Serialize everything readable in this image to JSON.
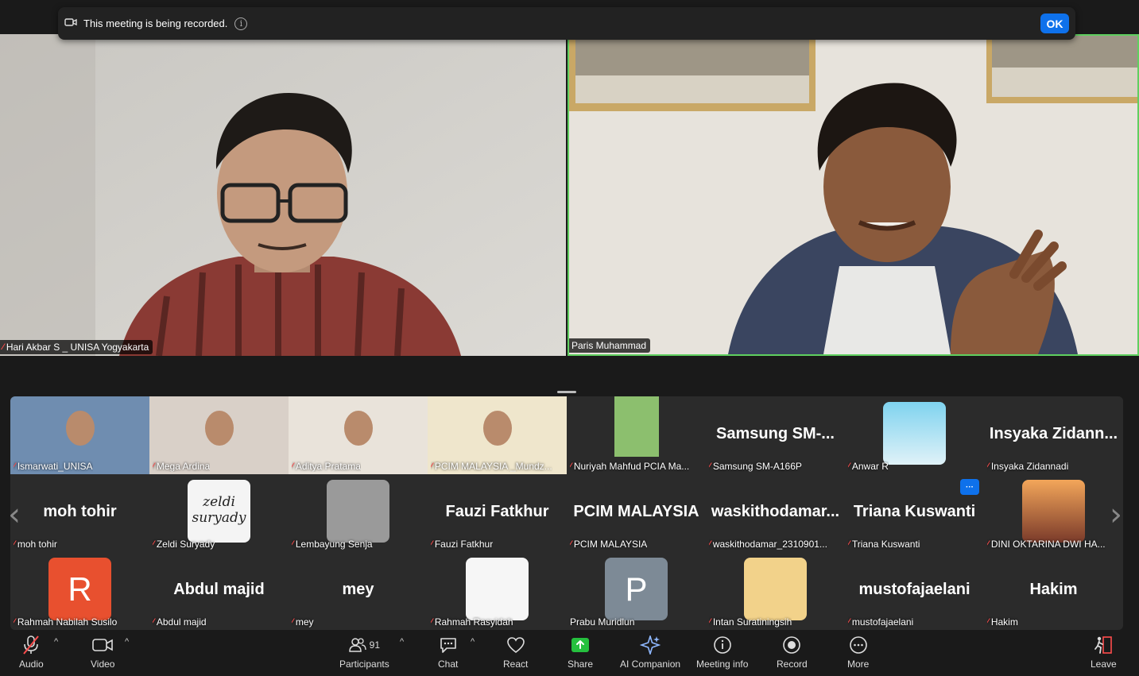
{
  "banner": {
    "text": "This meeting is being recorded.",
    "ok_label": "OK"
  },
  "speakers": [
    {
      "name": "Hari Akbar S _ UNISA Yogyakarta",
      "muted": true
    },
    {
      "name": "Paris Muhammad",
      "muted": false,
      "active": true
    }
  ],
  "gallery": {
    "rows": [
      [
        {
          "name": "Ismarwati_UNISA",
          "type": "video",
          "muted": true
        },
        {
          "name": "Mega Ardina",
          "type": "video",
          "muted": true
        },
        {
          "name": "Aditya Pratama",
          "type": "video",
          "muted": true
        },
        {
          "name": "PCIM MALAYSIA _Mundz...",
          "type": "video",
          "muted": true
        },
        {
          "name": "Nuriyah Mahfud PCIA Ma...",
          "type": "video",
          "muted": true
        },
        {
          "name": "Samsung SM-A166P",
          "display": "Samsung SM-...",
          "type": "name",
          "muted": true
        },
        {
          "name": "Anwar R",
          "type": "avatar",
          "muted": true
        },
        {
          "name": "Insyaka Zidannadi",
          "display": "Insyaka Zidann...",
          "type": "name",
          "muted": true
        }
      ],
      [
        {
          "name": "moh tohir",
          "display": "moh tohir",
          "type": "name",
          "muted": true
        },
        {
          "name": "Zeldi Suryady",
          "type": "avatar",
          "muted": true,
          "avatar_text": "zeldi suryady"
        },
        {
          "name": "Lembayung Senja",
          "type": "avatar",
          "muted": true
        },
        {
          "name": "Fauzi Fatkhur",
          "display": "Fauzi Fatkhur",
          "type": "name",
          "muted": true
        },
        {
          "name": "PCIM MALAYSIA",
          "display": "PCIM MALAYSIA",
          "type": "name",
          "muted": true
        },
        {
          "name": "waskithodamar_2310901...",
          "display": "waskithodamar...",
          "type": "name",
          "muted": true
        },
        {
          "name": "Triana Kuswanti",
          "display": "Triana Kuswanti",
          "type": "name",
          "muted": true
        },
        {
          "name": "DINI OKTARINA DWI HA...",
          "type": "avatar",
          "muted": true
        }
      ],
      [
        {
          "name": "Rahmah Nabilah Susilo",
          "type": "letter",
          "letter": "R",
          "color": "#e8502f",
          "muted": true
        },
        {
          "name": "Abdul majid",
          "display": "Abdul majid",
          "type": "name",
          "muted": true
        },
        {
          "name": "mey",
          "display": "mey",
          "type": "name",
          "muted": true
        },
        {
          "name": "Rahmah Rasyidah",
          "type": "avatar",
          "muted": true
        },
        {
          "name": "Prabu Muridlun",
          "type": "letter",
          "letter": "P",
          "color": "#7d8a96",
          "muted": false
        },
        {
          "name": "Intan Suratiningsih",
          "type": "avatar",
          "muted": true
        },
        {
          "name": "mustofajaelani",
          "display": "mustofajaelani",
          "type": "name",
          "muted": true
        },
        {
          "name": "Hakim",
          "display": "Hakim",
          "type": "name",
          "muted": true
        }
      ]
    ],
    "more_badge": "···"
  },
  "toolbar": {
    "audio": "Audio",
    "video": "Video",
    "participants": "Participants",
    "participants_count": "91",
    "chat": "Chat",
    "react": "React",
    "share": "Share",
    "ai_companion": "AI Companion",
    "meeting_info": "Meeting info",
    "record": "Record",
    "more": "More",
    "leave": "Leave"
  },
  "colors": {
    "accent": "#0e71eb",
    "active_speaker": "#5fcf5f",
    "muted": "#ff4d4d",
    "share": "#25c03e"
  }
}
